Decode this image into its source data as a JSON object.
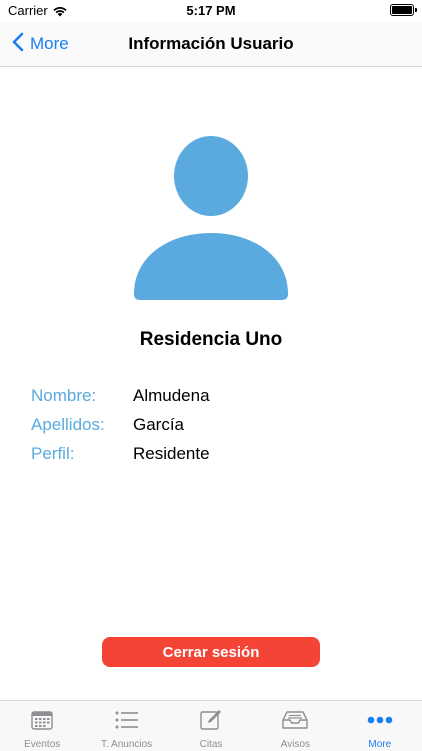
{
  "status_bar": {
    "carrier": "Carrier",
    "time": "5:17 PM"
  },
  "nav": {
    "back_label": "More",
    "title": "Información Usuario"
  },
  "profile": {
    "residence": "Residencia Uno",
    "fields": [
      {
        "label": "Nombre:",
        "value": "Almudena"
      },
      {
        "label": "Apellidos:",
        "value": "García"
      },
      {
        "label": "Perfil:",
        "value": "Residente"
      }
    ]
  },
  "logout_label": "Cerrar sesión",
  "tabs": [
    {
      "label": "Eventos",
      "icon": "calendar-icon"
    },
    {
      "label": "T. Anuncios",
      "icon": "list-icon"
    },
    {
      "label": "Citas",
      "icon": "edit-icon"
    },
    {
      "label": "Avisos",
      "icon": "inbox-icon"
    },
    {
      "label": "More",
      "icon": "more-icon"
    }
  ],
  "colors": {
    "accent": "#1a7ef5",
    "label": "#5aaadf",
    "avatar": "#5aaadf",
    "logout": "#f34436"
  }
}
